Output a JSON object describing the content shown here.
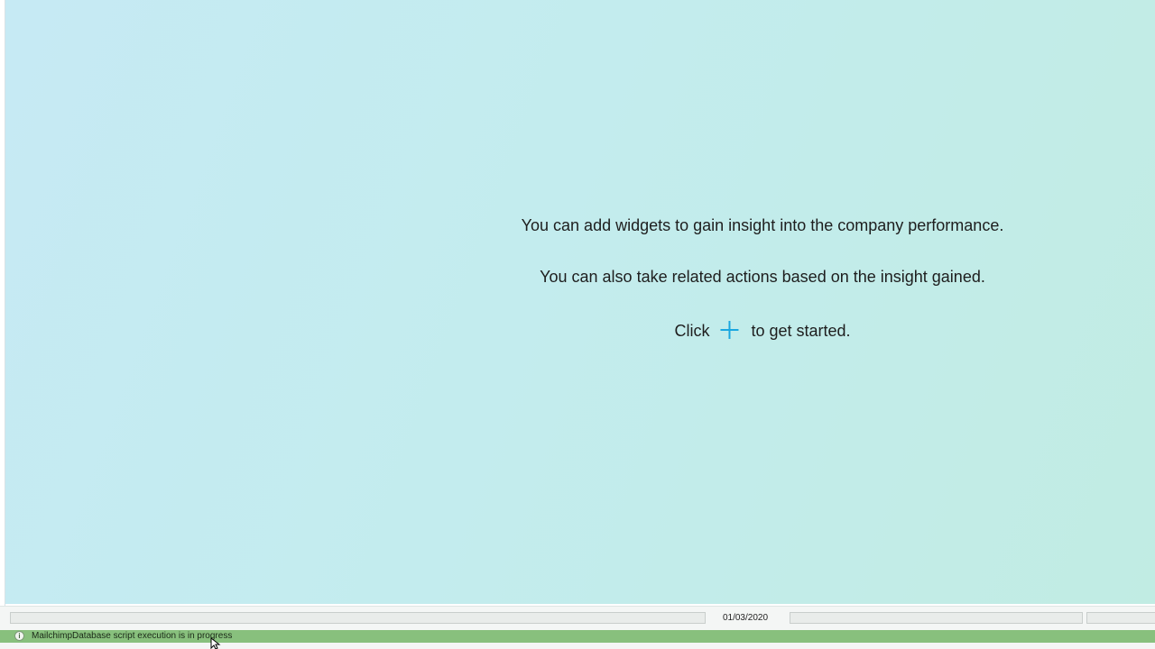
{
  "empty_state": {
    "line1": "You can add widgets to gain insight into the company performance.",
    "line2": "You can also take related actions based on the insight gained.",
    "line3_before": "Click",
    "line3_after": "to get started.",
    "plus_icon": "plus-icon"
  },
  "status": {
    "date": "01/03/2020",
    "message": "MailchimpDatabase script execution is in progress",
    "info_icon": "info-icon",
    "info_glyph": "i"
  },
  "colors": {
    "accent_plus": "#1aa7e0",
    "status_bar": "#88c07d"
  }
}
